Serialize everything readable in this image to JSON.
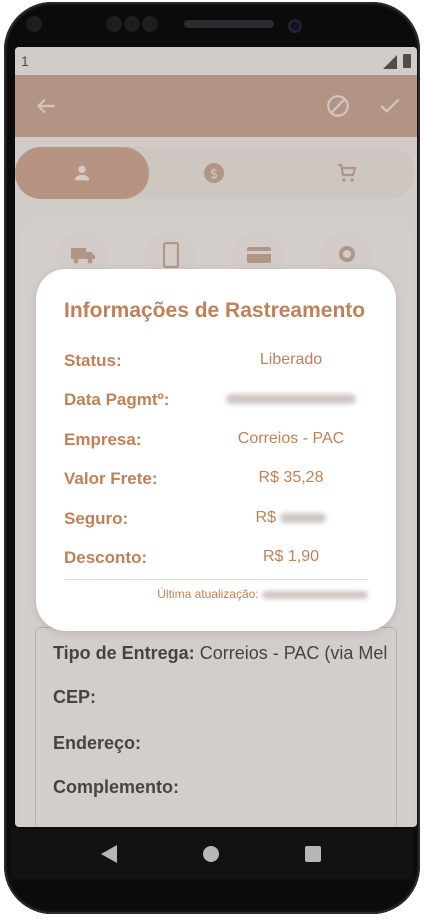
{
  "statusbar": {
    "time": "1"
  },
  "tabs": [
    "person-icon",
    "dollar-icon",
    "cart-icon"
  ],
  "background_details": {
    "tipo_label": "Tipo de Entrega:",
    "tipo_value": "Correios - PAC (via Mel",
    "cep_label": "CEP:",
    "endereco_label": "Endereço:",
    "complemento_label": "Complemento:"
  },
  "modal": {
    "title": "Informações de Rastreamento",
    "rows": [
      {
        "label": "Status:",
        "value": "Liberado"
      },
      {
        "label": "Data Pagmtº:",
        "value": ""
      },
      {
        "label": "Empresa:",
        "value": "Correios - PAC"
      },
      {
        "label": "Valor Frete:",
        "value": "R$ 35,28"
      },
      {
        "label": "Seguro:",
        "value": "R$"
      },
      {
        "label": "Desconto:",
        "value": "R$ 1,90"
      }
    ],
    "updated_label": "Última atualização:"
  },
  "colors": {
    "accent": "#c08158",
    "appbar": "#c7a08d"
  }
}
